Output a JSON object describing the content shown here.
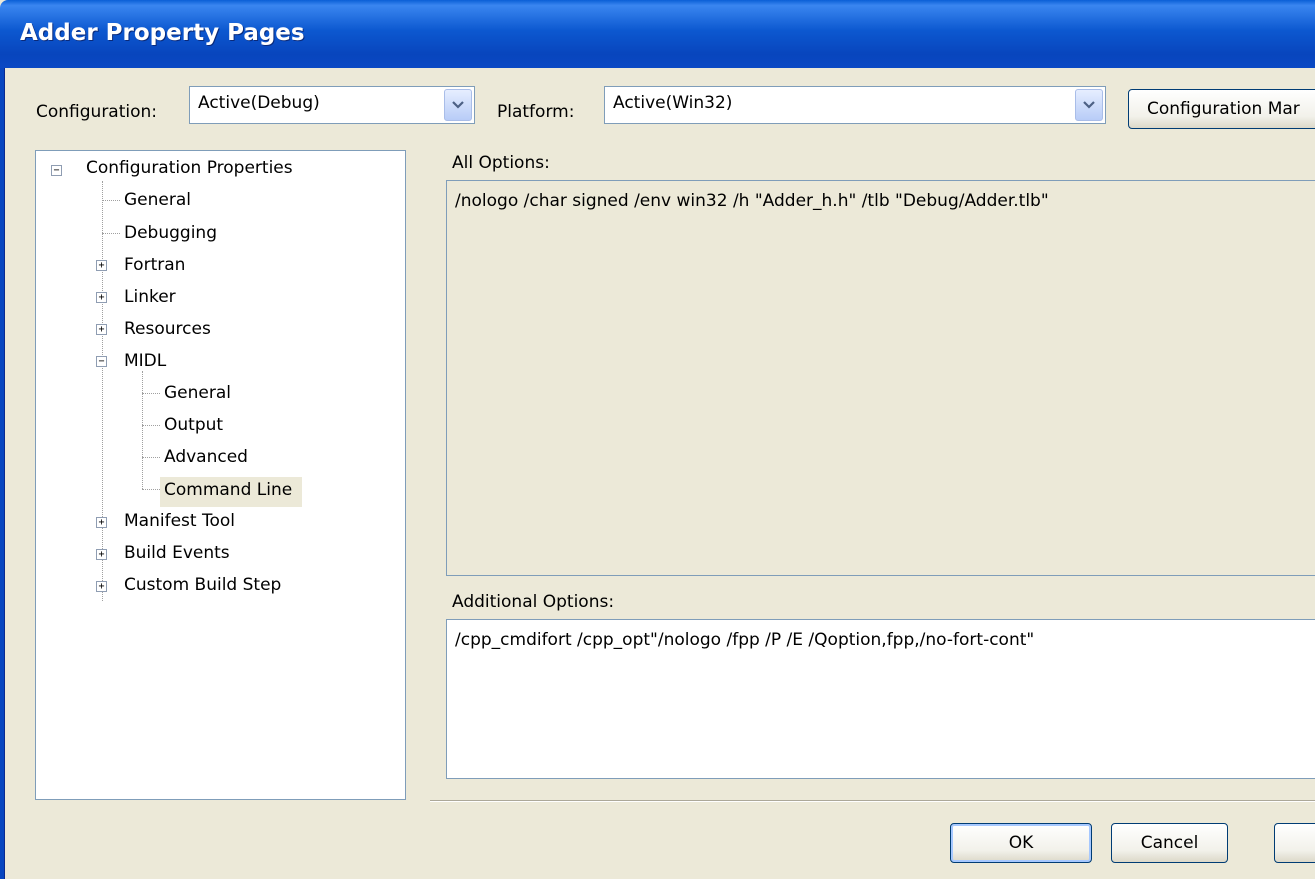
{
  "window": {
    "title": "Adder Property Pages"
  },
  "toolbar": {
    "configuration_label": "Configuration:",
    "configuration_value": "Active(Debug)",
    "platform_label": "Platform:",
    "platform_value": "Active(Win32)",
    "config_manager_label": "Configuration Mar"
  },
  "tree": {
    "root": "Configuration Properties",
    "items": {
      "general": "General",
      "debugging": "Debugging",
      "fortran": "Fortran",
      "linker": "Linker",
      "resources": "Resources",
      "midl": "MIDL",
      "midl_general": "General",
      "midl_output": "Output",
      "midl_advanced": "Advanced",
      "midl_command_line": "Command Line",
      "manifest_tool": "Manifest Tool",
      "build_events": "Build Events",
      "custom_build_step": "Custom Build Step"
    },
    "selected": "Command Line"
  },
  "main": {
    "all_options_label": "All Options:",
    "all_options_value": "/nologo /char signed /env win32 /h \"Adder_h.h\" /tlb \"Debug/Adder.tlb\"",
    "additional_options_label": "Additional Options:",
    "additional_options_value": "/cpp_cmdifort /cpp_opt\"/nologo /fpp /P /E /Qoption,fpp,/no-fort-cont\""
  },
  "buttons": {
    "ok": "OK",
    "cancel": "Cancel",
    "apply": ""
  },
  "colors": {
    "titlebar": "#0845bd",
    "face": "#ece9d8",
    "border": "#7f9db9"
  }
}
